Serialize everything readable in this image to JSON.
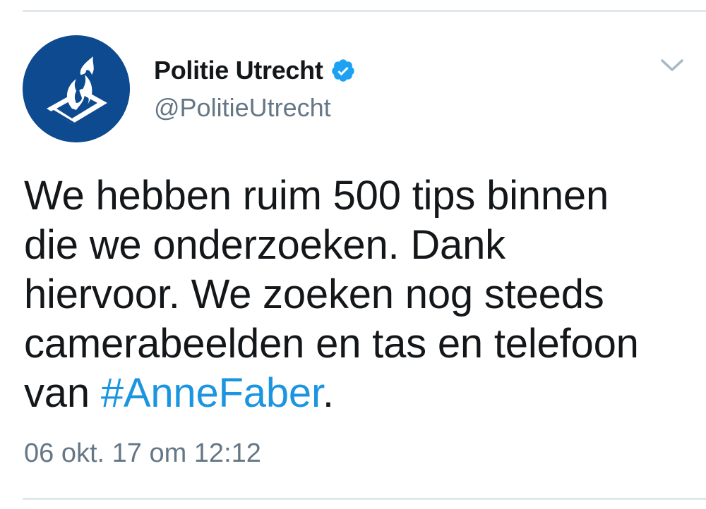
{
  "tweet": {
    "author": {
      "display_name": "Politie Utrecht",
      "handle": "@PolitieUtrecht",
      "verified": true,
      "avatar_icon": "police-flame-logo-icon"
    },
    "text": {
      "line1": "We hebben ruim 500 tips binnen",
      "line2": "die we onderzoeken. Dank",
      "line3": "hiervoor. We zoeken nog steeds",
      "line4": "camerabeelden en tas en telefoon",
      "line5_prefix": "van ",
      "hashtag": "#AnneFaber",
      "line5_suffix": "."
    },
    "timestamp": "06 okt. 17 om 12:12",
    "menu_icon": "chevron-down-icon"
  },
  "colors": {
    "avatar_bg": "#0d4a8f",
    "verified_badge": "#1da1f2",
    "hashtag": "#1b95e0",
    "secondary_text": "#657786",
    "divider": "#e1e8ed"
  }
}
